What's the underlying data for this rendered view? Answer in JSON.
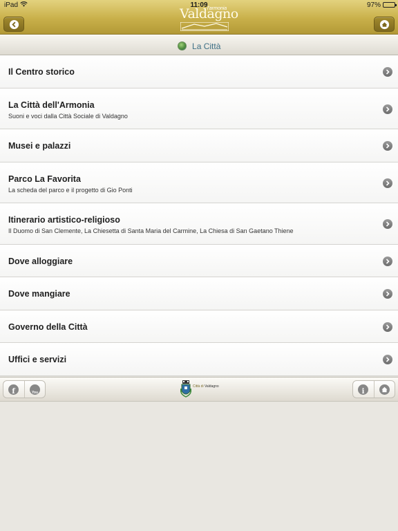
{
  "status_bar": {
    "carrier": "iPad",
    "time": "11:09",
    "battery": "97%"
  },
  "header": {
    "logo_tagline": "l'armonia",
    "logo_name": "Valdagno",
    "back_icon": "chevron-left-icon",
    "home_icon": "home-icon"
  },
  "section": {
    "title": "La Città",
    "icon": "globe-icon"
  },
  "list": {
    "items": [
      {
        "title": "Il Centro storico",
        "subtitle": ""
      },
      {
        "title": "La Città dell'Armonia",
        "subtitle": "Suoni e voci dalla Città Sociale di Valdagno"
      },
      {
        "title": "Musei e palazzi",
        "subtitle": ""
      },
      {
        "title": "Parco La Favorita",
        "subtitle": "La scheda del parco e il progetto di Gio Ponti"
      },
      {
        "title": "Itinerario artistico-religioso",
        "subtitle": "Il Duomo di San Clemente, La Chiesetta di Santa Maria del Carmine, La Chiesa di San Gaetano Thiene"
      },
      {
        "title": "Dove alloggiare",
        "subtitle": ""
      },
      {
        "title": "Dove mangiare",
        "subtitle": ""
      },
      {
        "title": "Governo della Città",
        "subtitle": ""
      },
      {
        "title": "Uffici e servizi",
        "subtitle": ""
      }
    ]
  },
  "footer": {
    "facebook_glyph": "f",
    "youtube_glyph": "You",
    "crest_prefix": "Città di",
    "crest_name": "Valdagno",
    "info_glyph": "i"
  },
  "colors": {
    "header_gold": "#c9b04a",
    "section_title": "#3d6f86",
    "chevron": "#7a7a7a"
  }
}
